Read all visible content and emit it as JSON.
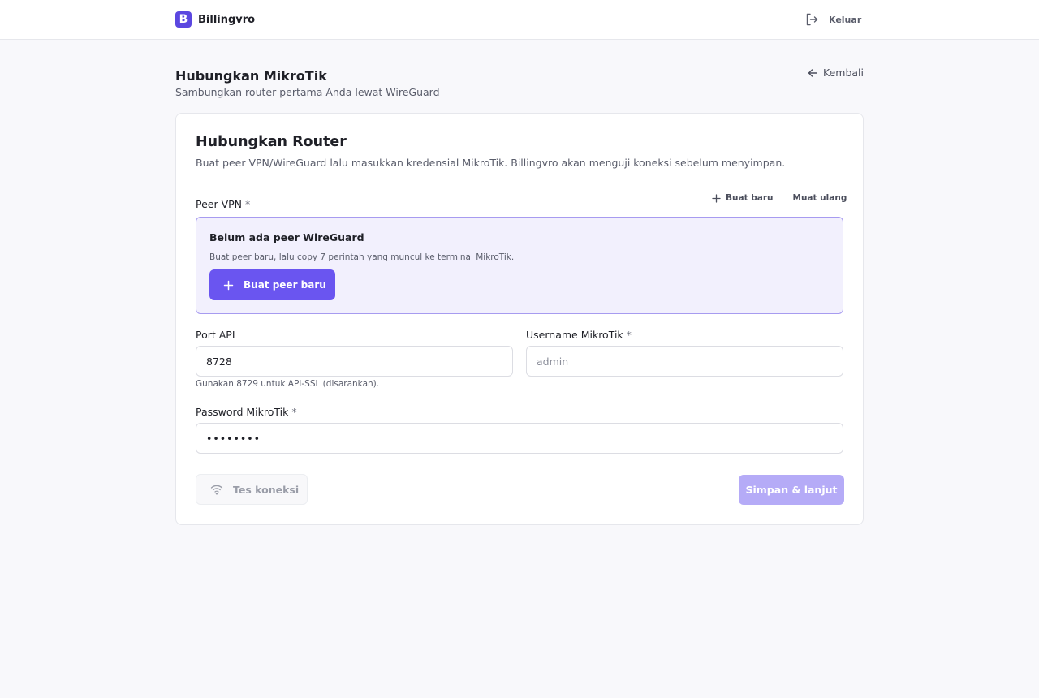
{
  "brand": {
    "name": "Billingvro",
    "logo_letter": "B"
  },
  "header": {
    "logout_label": "Keluar"
  },
  "page": {
    "title": "Hubungkan MikroTik",
    "subtitle": "Sambungkan router pertama Anda lewat WireGuard",
    "back_label": "Kembali"
  },
  "card": {
    "title": "Hubungkan Router",
    "description": "Buat peer VPN/WireGuard lalu masukkan kredensial MikroTik. Billingvro akan menguji koneksi sebelum menyimpan."
  },
  "peer": {
    "label": "Peer VPN",
    "required_mark": "*",
    "new_label": "Buat baru",
    "reload_label": "Muat ulang",
    "empty_title": "Belum ada peer WireGuard",
    "empty_desc": "Buat peer baru, lalu copy 7 perintah yang muncul ke terminal MikroTik.",
    "create_button": "Buat peer baru"
  },
  "port": {
    "label": "Port API",
    "value": "8728",
    "hint": "Gunakan 8729 untuk API-SSL (disarankan)."
  },
  "username": {
    "label": "Username MikroTik",
    "required_mark": "*",
    "placeholder": "admin",
    "value": ""
  },
  "password": {
    "label": "Password MikroTik",
    "required_mark": "*",
    "value": "••••••••"
  },
  "footer": {
    "test_label": "Tes koneksi",
    "save_label": "Simpan & lanjut"
  },
  "colors": {
    "accent": "#6a55f0",
    "accent_disabled": "#b5abf7",
    "peer_box_bg": "#f2f0fd",
    "peer_box_border": "#a79bf0",
    "page_bg": "#f8f8fb"
  },
  "icons": {
    "logout": "logout-icon",
    "back": "arrow-left-icon",
    "plus": "plus-icon",
    "wifi": "wifi-icon"
  }
}
